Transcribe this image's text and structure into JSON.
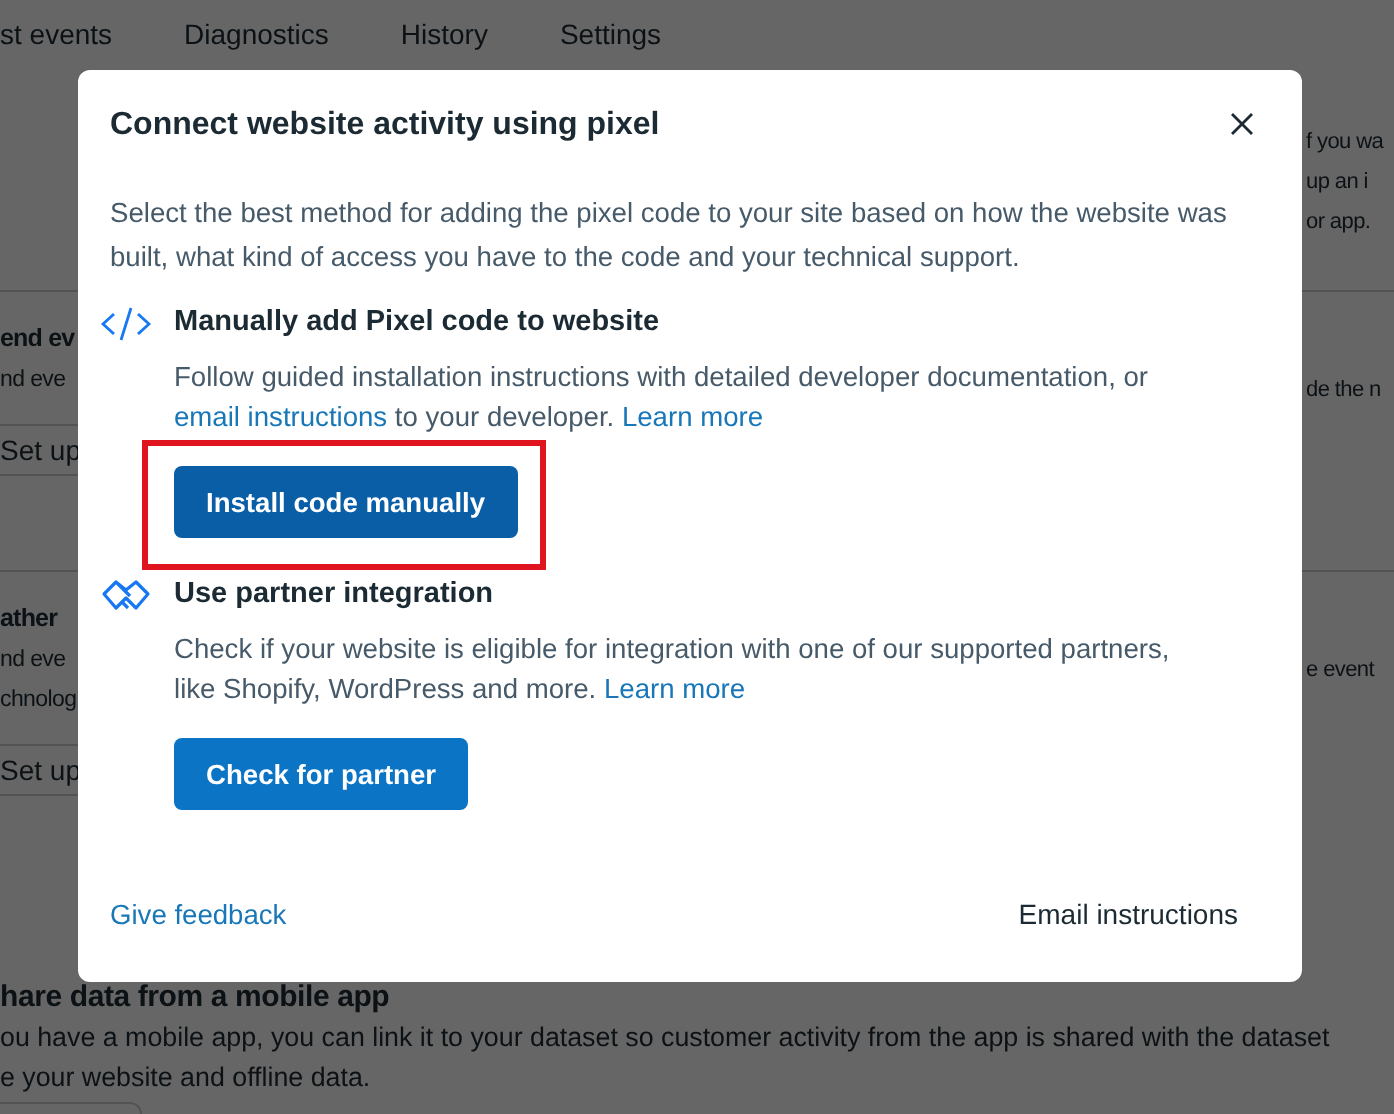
{
  "background": {
    "tabs": [
      {
        "label": "st events"
      },
      {
        "label": "Diagnostics"
      },
      {
        "label": "History"
      },
      {
        "label": "Settings"
      }
    ],
    "intro_lines": [
      "f you wa",
      "up an i",
      "or app."
    ],
    "sections": [
      {
        "heading": "end ev",
        "lines": [
          "nd eve"
        ],
        "side_lines": [
          "de the n"
        ],
        "button": "Set up"
      },
      {
        "heading": "ather",
        "lines": [
          "nd eve",
          "chnolog"
        ],
        "side_lines": [
          "e event"
        ],
        "button": "Set up"
      }
    ],
    "mobile_section": {
      "heading": "hare data from a mobile app",
      "lines": [
        "ou have a mobile app, you can link it to your dataset so customer activity from the app is shared with the dataset",
        "e your website and offline data."
      ]
    }
  },
  "dialog": {
    "title": "Connect website activity using pixel",
    "description": "Select the best method for adding the pixel code to your site based on how the website was built, what kind of access you have to the code and your technical support.",
    "options": [
      {
        "kind": "code",
        "title": "Manually add Pixel code to website",
        "description": [
          {
            "text": "Follow guided installation instructions with detailed developer documentation, or "
          },
          {
            "text": "email instructions",
            "link": true
          },
          {
            "text": " to your developer. "
          },
          {
            "text": "Learn more",
            "link": true
          }
        ],
        "button": "Install code manually",
        "button_hovered": true,
        "highlighted": true
      },
      {
        "kind": "handshake",
        "title": "Use partner integration",
        "description": [
          {
            "text": "Check if your website is eligible for integration with one of our supported partners, like Shopify, WordPress and more. "
          },
          {
            "text": "Learn more",
            "link": true
          }
        ],
        "button": "Check for partner",
        "button_hovered": false,
        "highlighted": false
      }
    ],
    "footer": {
      "feedback_link": "Give feedback",
      "secondary_button": "Email instructions"
    }
  }
}
